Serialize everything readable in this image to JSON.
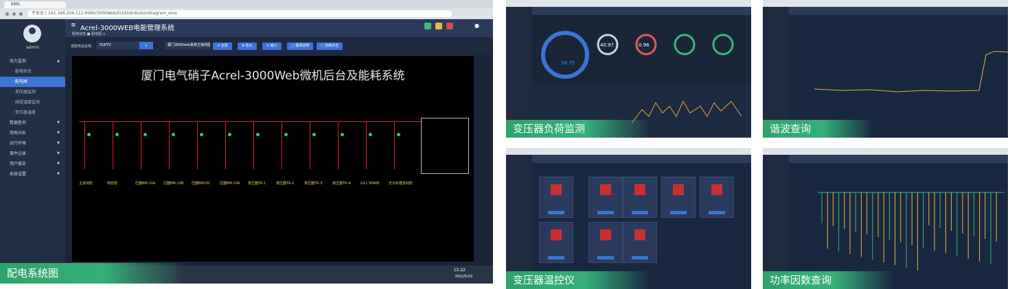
{
  "panels": {
    "main": {
      "caption": "配电系统图",
      "browser": {
        "tab": "EMS",
        "address": "不安全 | 192.168.204.112:9090/3000Web/EU/DistributionDiagram_ems"
      },
      "app_title": "Acrel-3000WEB电能管理系统",
      "breadcrumb": "配电状态  ■ 配电图 ×",
      "user": "admin",
      "menu": [
        {
          "label": "电力监测",
          "active": false,
          "expanded": true
        },
        {
          "label": "· 配电状态",
          "sub": true
        },
        {
          "label": "· 配电图",
          "sub": true,
          "active": true
        },
        {
          "label": "· 变压器监测",
          "sub": true
        },
        {
          "label": "· 线缆温度监测",
          "sub": true
        },
        {
          "label": "· 变压器温度",
          "sub": true
        },
        {
          "label": "数据查询"
        },
        {
          "label": "用电分析"
        },
        {
          "label": "运行环境"
        },
        {
          "label": "事件记录"
        },
        {
          "label": "用户报告"
        },
        {
          "label": "系统设置"
        }
      ],
      "toolbar": {
        "name_label": "变配电站名称:",
        "name_value": "EGKTV",
        "diagram_select": "厦门3000web系统主接线图",
        "btn_fullscreen": "✛ 全屏",
        "btn_zoom_in": "⊕ 放大",
        "btn_zoom_out": "⊖ 缩小",
        "btn_legend": "□ 图例说明",
        "btn_log": "□ 控制日志"
      },
      "diagram_title": "厦门电气硝子Acrel-3000Web微机后台及能耗系统",
      "feeders": [
        "主进线柜",
        "电容柜",
        "压器BM-10A",
        "压器BM-10B",
        "压器BM10C",
        "压器BM-10A",
        "变压器TR-1",
        "变压器TR-2",
        "变压器TR-3",
        "变压器TR-4",
        "G12 SPARE",
        "无功补偿进线柜"
      ],
      "clock": {
        "time": "15:22",
        "date": "2022/5/19"
      }
    },
    "transformer_load": {
      "caption": "变压器负荷监测",
      "gauges": [
        "18.75",
        "40.97",
        "0.96"
      ]
    },
    "harmonic": {
      "caption": "谐波查询"
    },
    "temperature": {
      "caption": "变压器温控仪"
    },
    "power_factor": {
      "caption": "功率因数查询"
    }
  },
  "colors": {
    "accent": "#3b74d4",
    "caption_green": "#35b07a",
    "busbar_red": "#d8232a"
  }
}
